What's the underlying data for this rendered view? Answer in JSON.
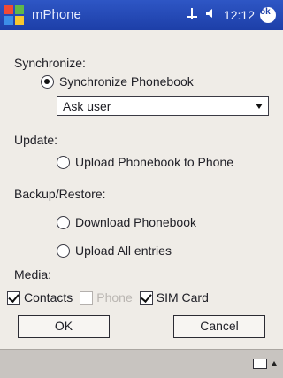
{
  "titlebar": {
    "title": "mPhone",
    "time": "12:12",
    "ok": "ok"
  },
  "sections": {
    "synchronize": "Synchronize:",
    "update": "Update:",
    "backup": "Backup/Restore:",
    "media": "Media:"
  },
  "options": {
    "sync_phonebook": "Synchronize Phonebook",
    "ask_user": "Ask user",
    "upload_phonebook": "Upload Phonebook to Phone",
    "download_phonebook": "Download Phonebook",
    "upload_all": "Upload All entries"
  },
  "media": {
    "contacts": "Contacts",
    "phone": "Phone",
    "sim": "SIM Card"
  },
  "buttons": {
    "ok": "OK",
    "cancel": "Cancel"
  }
}
